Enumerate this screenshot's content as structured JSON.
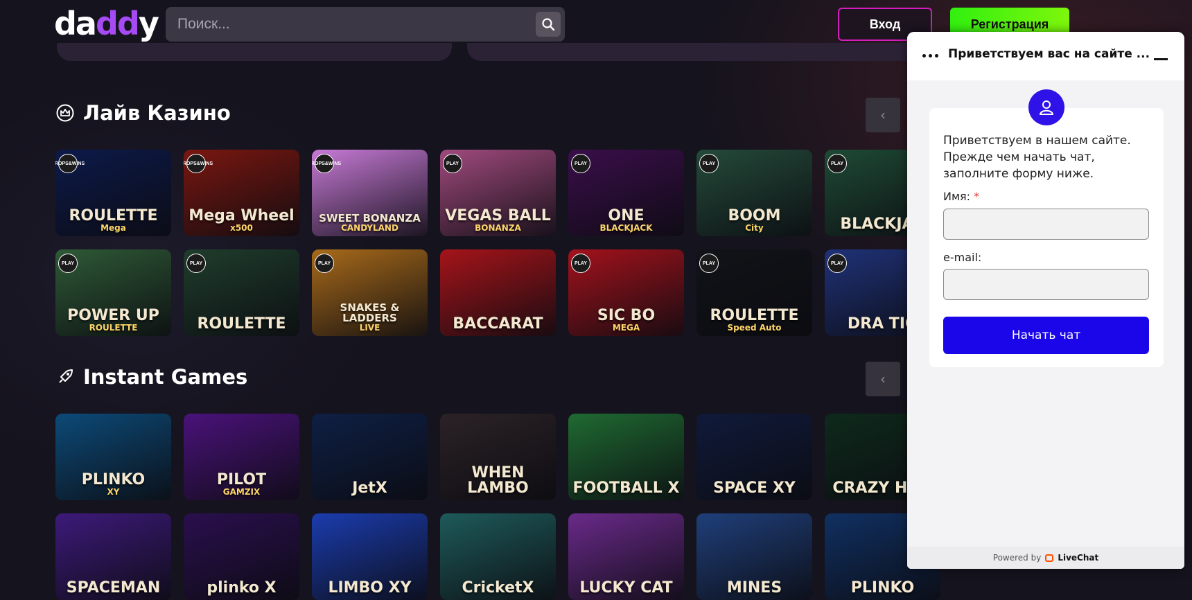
{
  "header": {
    "logo_prefix": "da",
    "logo_mid": "dd",
    "logo_suffix": "y",
    "search_placeholder": "Поиск...",
    "login_label": "Вход",
    "register_label": "Регистрация"
  },
  "live_casino": {
    "title": "Лайв Казино",
    "row1": [
      {
        "label": "ROULETTE",
        "sub": "Mega",
        "bg": "#0d1a4a",
        "badge": "DROPS&WINS"
      },
      {
        "label": "Mega Wheel",
        "sub": "x500",
        "bg": "#7a1710",
        "badge": "DROPS&WINS"
      },
      {
        "label": "SWEET BONANZA",
        "sub": "CANDYLAND",
        "bg": "#c77ad6",
        "badge": "DROPS&WINS"
      },
      {
        "label": "VEGAS BALL",
        "sub": "BONANZA",
        "bg": "#a04a7d",
        "badge": "PLAY"
      },
      {
        "label": "ONE",
        "sub": "BLACKJACK",
        "bg": "#3a0e4a",
        "badge": "PLAY"
      },
      {
        "label": "BOOM",
        "sub": "City",
        "bg": "#244a3a",
        "badge": "PLAY"
      },
      {
        "label": "BLACKJAC",
        "sub": "",
        "bg": "#1e4a35",
        "badge": "PLAY"
      }
    ],
    "row2": [
      {
        "label": "POWER UP",
        "sub": "ROULETTE",
        "bg": "#2e5a36",
        "badge": "PLAY"
      },
      {
        "label": "ROULETTE",
        "sub": "",
        "bg": "#1f3d2c",
        "badge": "PLAY"
      },
      {
        "label": "SNAKES & LADDERS",
        "sub": "LIVE",
        "bg": "#a86a1a",
        "badge": "PLAY"
      },
      {
        "label": "BACCARAT",
        "sub": "",
        "bg": "#a5141a",
        "badge": ""
      },
      {
        "label": "SIC BO",
        "sub": "MEGA",
        "bg": "#a3121c",
        "badge": "PLAY"
      },
      {
        "label": "ROULETTE",
        "sub": "Speed Auto",
        "bg": "#111318",
        "badge": "PLAY"
      },
      {
        "label": "DRA TIG",
        "sub": "",
        "bg": "#1f3278",
        "badge": "PLAY"
      }
    ]
  },
  "instant_games": {
    "title": "Instant Games",
    "row1": [
      {
        "label": "PLINKO",
        "sub": "XY",
        "bg": "#0c4a78"
      },
      {
        "label": "PILOT",
        "sub": "GAMZIX",
        "bg": "#4a127a"
      },
      {
        "label": "JetX",
        "sub": "",
        "bg": "#0e1f44"
      },
      {
        "label": "WHEN LAMBO",
        "sub": "",
        "bg": "#2b2226"
      },
      {
        "label": "FOOTBALL X",
        "sub": "",
        "bg": "#1f6a32"
      },
      {
        "label": "SPACE XY",
        "sub": "",
        "bg": "#101a3a"
      },
      {
        "label": "CRAZY HUN",
        "sub": "",
        "bg": "#0e2a1c"
      }
    ],
    "row2": [
      {
        "label": "SPACEMAN",
        "sub": "",
        "bg": "#3d1a7a"
      },
      {
        "label": "plinko X",
        "sub": "",
        "bg": "#2a0f4e"
      },
      {
        "label": "LIMBO XY",
        "sub": "",
        "bg": "#1b3cae"
      },
      {
        "label": "CricketX",
        "sub": "",
        "bg": "#1e5a5a"
      },
      {
        "label": "LUCKY CAT",
        "sub": "",
        "bg": "#6a2a8a"
      },
      {
        "label": "MINES",
        "sub": "",
        "bg": "#1f3f7a"
      },
      {
        "label": "PLINKO",
        "sub": "",
        "bg": "#103062"
      }
    ]
  },
  "chat": {
    "title": "Приветствуем вас на сайте ...",
    "intro": "Приветствуем в нашем сайте. Прежде чем начать чат, заполните форму ниже.",
    "name_label": "Имя:",
    "required_mark": "*",
    "email_label": "e-mail:",
    "start_label": "Начать чат",
    "powered_by": "Powered by",
    "brand": "LiveChat"
  },
  "colors": {
    "accent_purple": "#a64bf4",
    "register_green": "#31f00f",
    "login_border": "#d21ebc",
    "chat_button": "#1a06e8"
  }
}
